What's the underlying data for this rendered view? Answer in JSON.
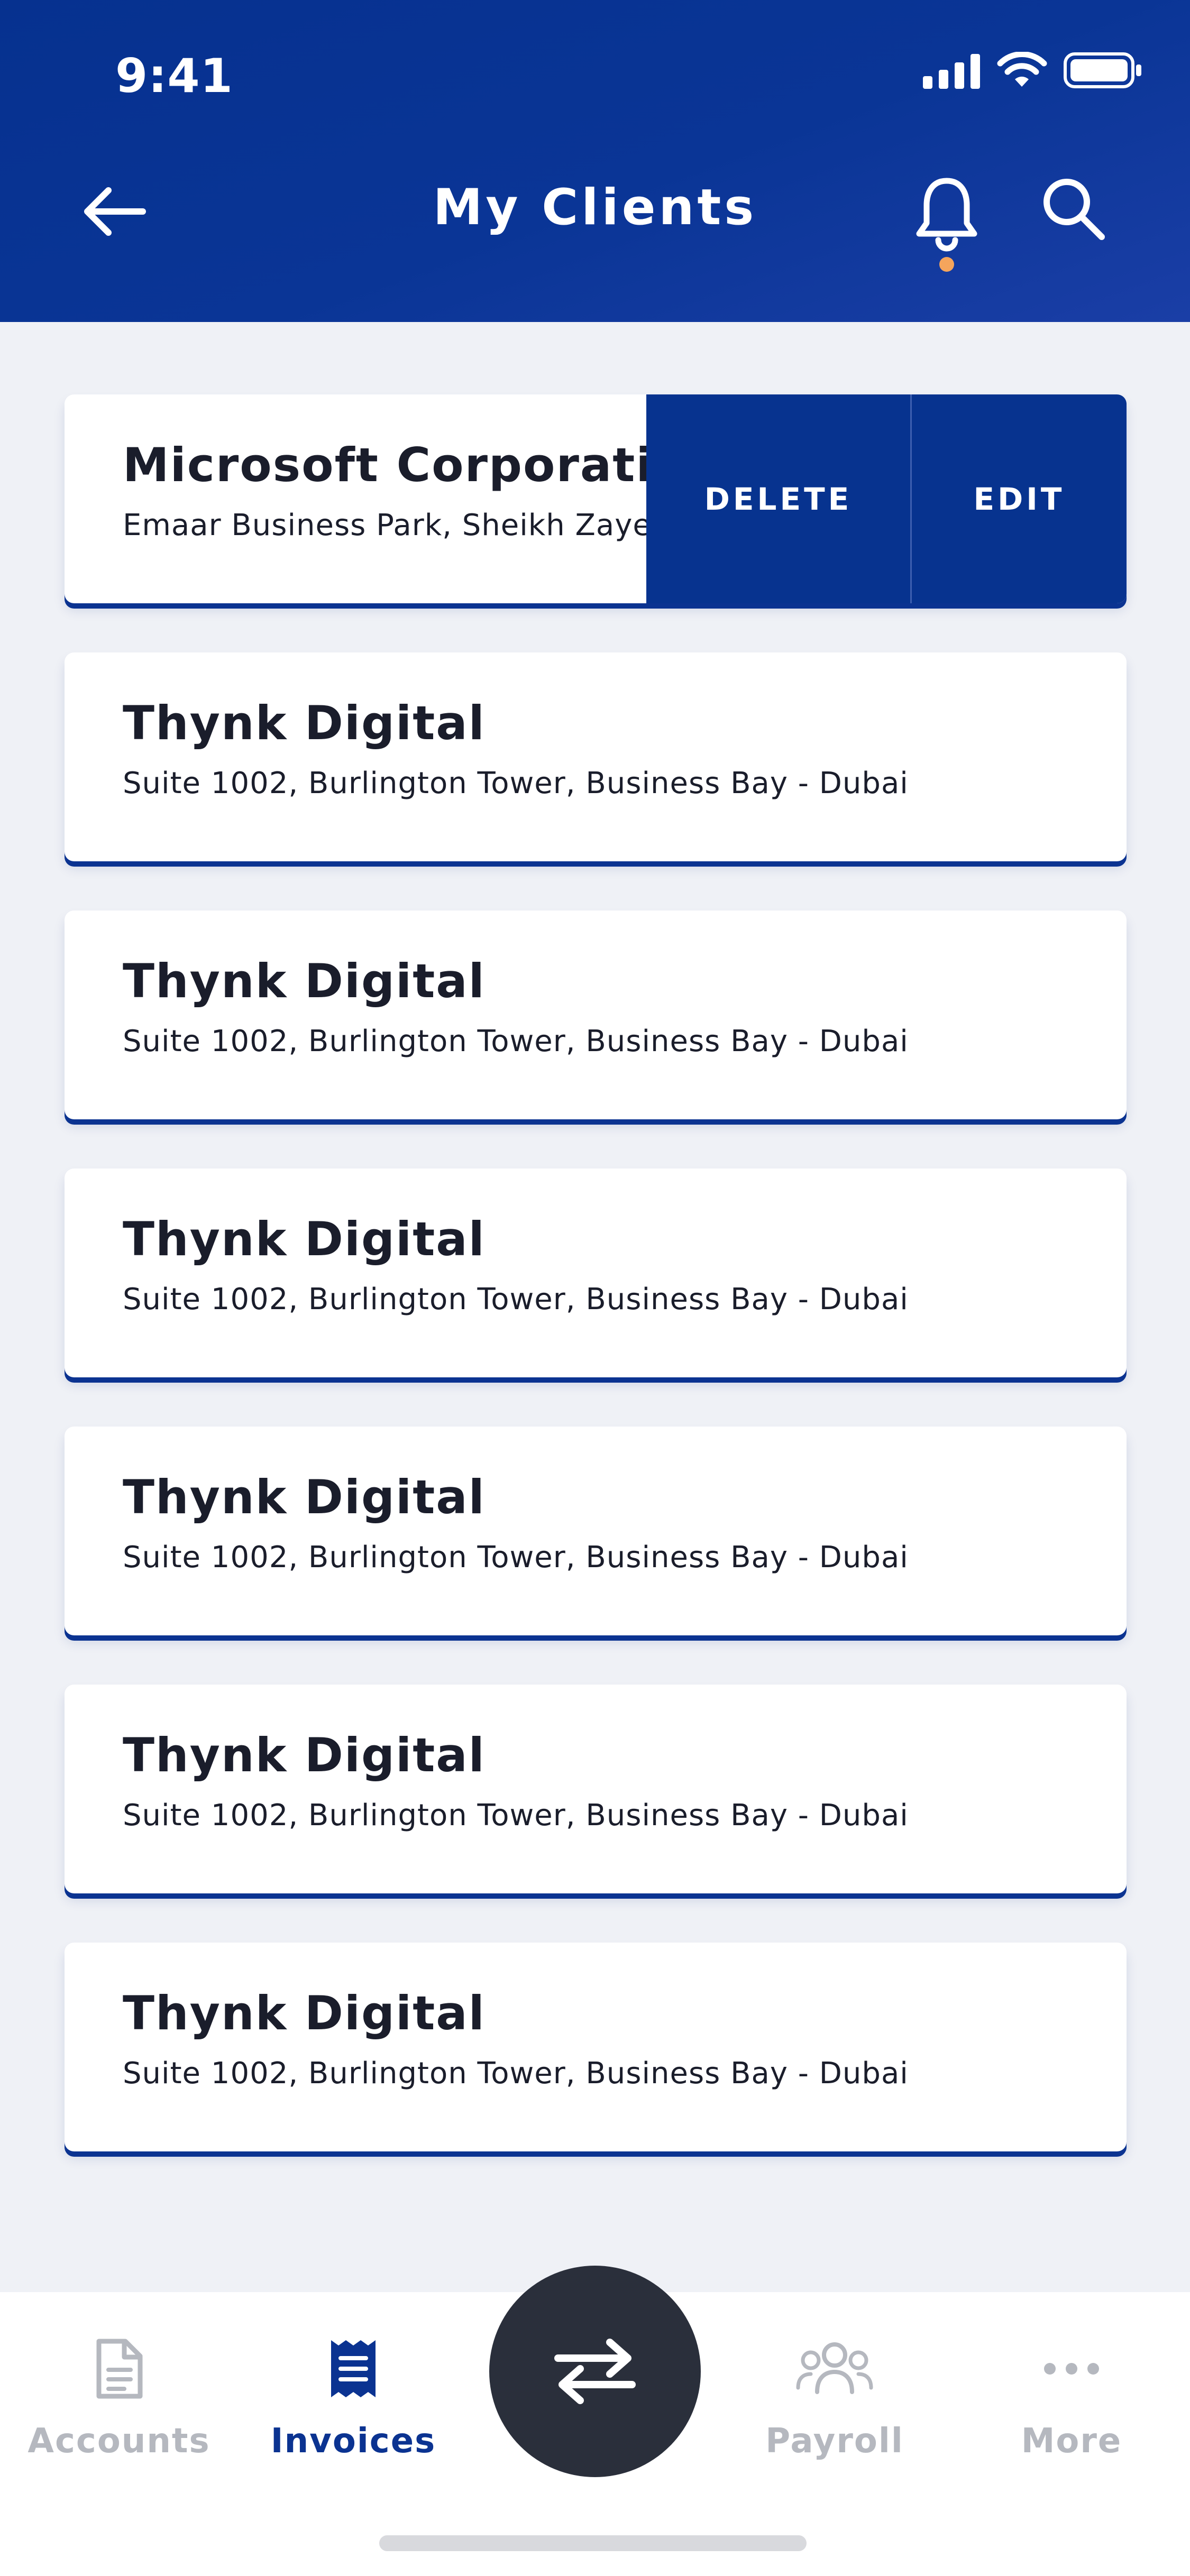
{
  "status": {
    "time": "9:41"
  },
  "header": {
    "title": "My Clients"
  },
  "swiped_card": {
    "name": "Microsoft Corporation",
    "address": "Emaar Business Park, Sheikh Zayed",
    "delete_label": "DELETE",
    "edit_label": "EDIT"
  },
  "clients": [
    {
      "name": "Thynk Digital",
      "address": "Suite 1002, Burlington Tower, Business Bay - Dubai"
    },
    {
      "name": "Thynk Digital",
      "address": "Suite 1002, Burlington Tower, Business Bay - Dubai"
    },
    {
      "name": "Thynk Digital",
      "address": "Suite 1002, Burlington Tower, Business Bay - Dubai"
    },
    {
      "name": "Thynk Digital",
      "address": "Suite 1002, Burlington Tower, Business Bay - Dubai"
    },
    {
      "name": "Thynk Digital",
      "address": "Suite 1002, Burlington Tower, Business Bay - Dubai"
    },
    {
      "name": "Thynk Digital",
      "address": "Suite 1002, Burlington Tower, Business Bay - Dubai"
    }
  ],
  "tabs": [
    {
      "label": "Accounts",
      "icon": "document-icon",
      "active": false
    },
    {
      "label": "Invoices",
      "icon": "receipt-icon",
      "active": true
    },
    {
      "label": "Payroll",
      "icon": "people-icon",
      "active": false
    },
    {
      "label": "More",
      "icon": "more-dots-icon",
      "active": false
    }
  ],
  "fab": {
    "icon": "transfer-arrows-icon"
  },
  "colors": {
    "header_blue": "#0a3596",
    "accent_blue": "#0b3391",
    "notification_dot": "#f5a55c",
    "fab_dark": "#2a2f3b",
    "tab_inactive": "#b5b8bf"
  }
}
